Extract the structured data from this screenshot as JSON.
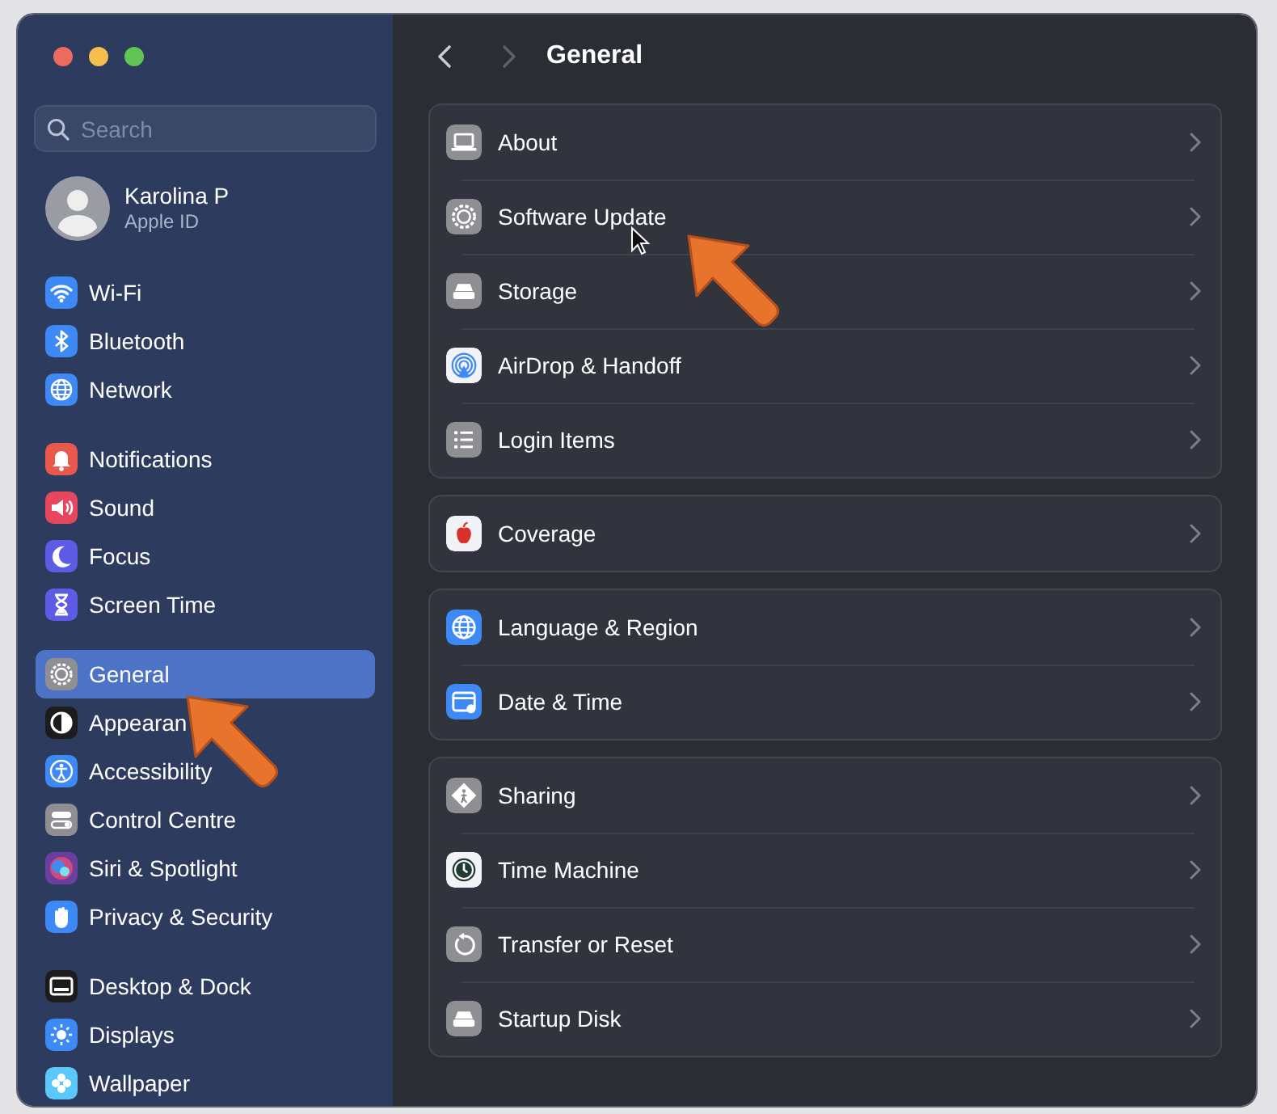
{
  "sidebar": {
    "search": {
      "placeholder": "Search"
    },
    "account": {
      "name": "Karolina P",
      "subtitle": "Apple ID"
    },
    "groups": [
      [
        {
          "label": "Wi-Fi",
          "selected": false,
          "color": "#3d8af7"
        },
        {
          "label": "Bluetooth",
          "selected": false,
          "color": "#3d8af7"
        },
        {
          "label": "Network",
          "selected": false,
          "color": "#3d8af7"
        }
      ],
      [
        {
          "label": "Notifications",
          "selected": false,
          "color": "#e8584d"
        },
        {
          "label": "Sound",
          "selected": false,
          "color": "#e6475f"
        },
        {
          "label": "Focus",
          "selected": false,
          "color": "#5e5ce6"
        },
        {
          "label": "Screen Time",
          "selected": false,
          "color": "#5e5ce6"
        }
      ],
      [
        {
          "label": "General",
          "selected": true,
          "color": "#8e8e93"
        },
        {
          "label": "Appearan",
          "selected": false,
          "color": "#1c1c1e"
        },
        {
          "label": "Accessibility",
          "selected": false,
          "color": "#3d8af7"
        },
        {
          "label": "Control Centre",
          "selected": false,
          "color": "#8e8e93"
        },
        {
          "label": "Siri & Spotlight",
          "selected": false,
          "color": "#6b3fa0"
        },
        {
          "label": "Privacy & Security",
          "selected": false,
          "color": "#3d8af7"
        }
      ],
      [
        {
          "label": "Desktop & Dock",
          "selected": false,
          "color": "#1c1c1e"
        },
        {
          "label": "Displays",
          "selected": false,
          "color": "#3d8af7"
        },
        {
          "label": "Wallpaper",
          "selected": false,
          "color": "#5ac8fa"
        }
      ]
    ]
  },
  "toolbar": {
    "back": {
      "disabled": false
    },
    "forward": {
      "disabled": true
    },
    "title": "General"
  },
  "groups": [
    [
      {
        "label": "About",
        "color": "#8e8e93"
      },
      {
        "label": "Software Update",
        "color": "#8e8e93"
      },
      {
        "label": "Storage",
        "color": "#8e8e93"
      },
      {
        "label": "AirDrop & Handoff",
        "color": "#f2f2f7"
      },
      {
        "label": "Login Items",
        "color": "#8e8e93"
      }
    ],
    [
      {
        "label": "Coverage",
        "color": "#f2f2f7"
      }
    ],
    [
      {
        "label": "Language & Region",
        "color": "#3d8af7"
      },
      {
        "label": "Date & Time",
        "color": "#3d8af7"
      }
    ],
    [
      {
        "label": "Sharing",
        "color": "#8e8e93"
      },
      {
        "label": "Time Machine",
        "color": "#f2f2f7"
      },
      {
        "label": "Transfer or Reset",
        "color": "#8e8e93"
      },
      {
        "label": "Startup Disk",
        "color": "#8e8e93"
      }
    ]
  ]
}
